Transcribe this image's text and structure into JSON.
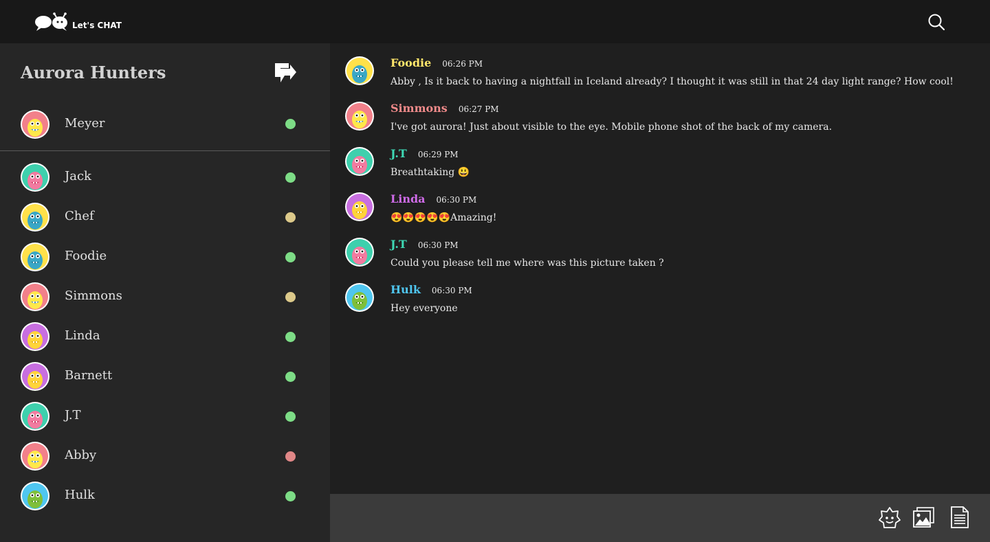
{
  "app": {
    "logo_text": "Let's CHAT"
  },
  "group": {
    "title": "Aurora Hunters"
  },
  "colors": {
    "online": "#7ddc86",
    "away": "#dcc98a",
    "busy": "#e08787",
    "topbar": "#181818",
    "sidebar": "#262626",
    "composer": "#3b3b3b"
  },
  "me": {
    "name": "Meyer",
    "avatar": "pink-yellow-monster",
    "status": "online"
  },
  "members": [
    {
      "name": "Jack",
      "avatar": "teal-pink-monster",
      "status": "online"
    },
    {
      "name": "Chef",
      "avatar": "yellow-blue-monster",
      "status": "away"
    },
    {
      "name": "Foodie",
      "avatar": "yellow-blue-monster",
      "status": "online"
    },
    {
      "name": "Simmons",
      "avatar": "pink-yellow-monster",
      "status": "away"
    },
    {
      "name": "Linda",
      "avatar": "purple-yellow-monster",
      "status": "online"
    },
    {
      "name": "Barnett",
      "avatar": "purple-yellow-monster",
      "status": "online"
    },
    {
      "name": "J.T",
      "avatar": "teal-pink-monster",
      "status": "online"
    },
    {
      "name": "Abby",
      "avatar": "pink-yellow-monster",
      "status": "busy"
    },
    {
      "name": "Hulk",
      "avatar": "blue-green-monster",
      "status": "online"
    }
  ],
  "messages": [
    {
      "author": "Foodie",
      "color": "#ffe66b",
      "time": "06:26 PM",
      "avatar": "yellow-blue-monster",
      "text": "Abby , Is it back to having a nightfall in Iceland already? I thought it was still in that 24 day light range? How cool!"
    },
    {
      "author": "Simmons",
      "color": "#f08a8a",
      "time": "06:27 PM",
      "avatar": "pink-yellow-monster",
      "text": "I've got aurora! Just about visible to the eye. Mobile phone shot of the back of my camera."
    },
    {
      "author": "J.T",
      "color": "#3ed8b4",
      "time": "06:29 PM",
      "avatar": "teal-pink-monster",
      "text": "Breathtaking 😃"
    },
    {
      "author": "Linda",
      "color": "#cf6be8",
      "time": "06:30 PM",
      "avatar": "purple-yellow-monster",
      "text": "😍😍😍😍😍Amazing!"
    },
    {
      "author": "J.T",
      "color": "#3ed8b4",
      "time": "06:30 PM",
      "avatar": "teal-pink-monster",
      "text": "Could you please tell me where was this picture taken ?"
    },
    {
      "author": "Hulk",
      "color": "#4fc6f0",
      "time": "06:30 PM",
      "avatar": "blue-green-monster",
      "text": "Hey everyone"
    }
  ],
  "icons": {
    "search": "search-icon",
    "exit": "exit-group-icon",
    "emoji": "emoji-icon",
    "image": "image-icon",
    "document": "document-icon"
  }
}
